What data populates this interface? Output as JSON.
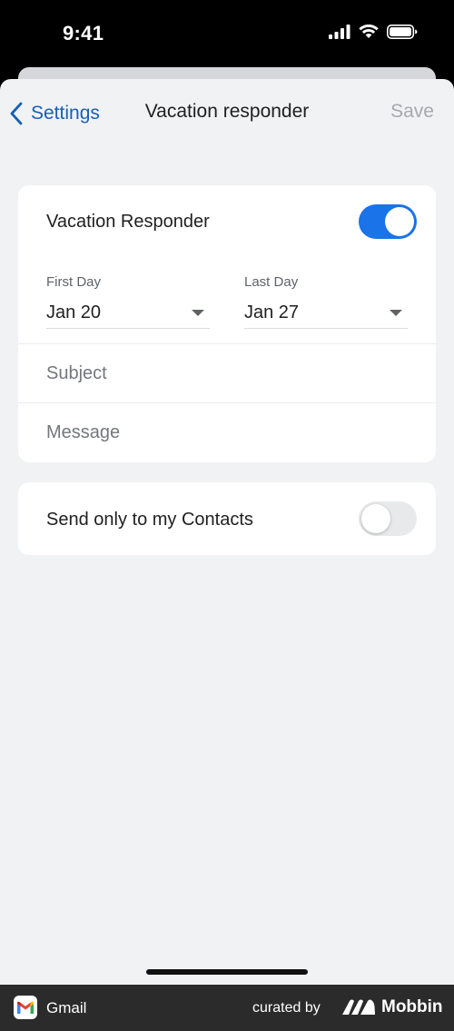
{
  "status_bar": {
    "time": "9:41"
  },
  "nav": {
    "back_label": "Settings",
    "title": "Vacation responder",
    "save_label": "Save"
  },
  "responder": {
    "label": "Vacation Responder",
    "enabled": true
  },
  "dates": {
    "first": {
      "label": "First Day",
      "value": "Jan 20"
    },
    "last": {
      "label": "Last Day",
      "value": "Jan 27"
    }
  },
  "fields": {
    "subject": {
      "placeholder": "Subject",
      "value": ""
    },
    "message": {
      "placeholder": "Message",
      "value": ""
    }
  },
  "contacts": {
    "label": "Send only to my Contacts",
    "enabled": false
  },
  "footer": {
    "app_name": "Gmail",
    "curated_by": "curated by",
    "brand": "Mobbin"
  },
  "colors": {
    "accent": "#1a73e8",
    "link": "#1a5fb4",
    "background": "#f1f2f4"
  }
}
